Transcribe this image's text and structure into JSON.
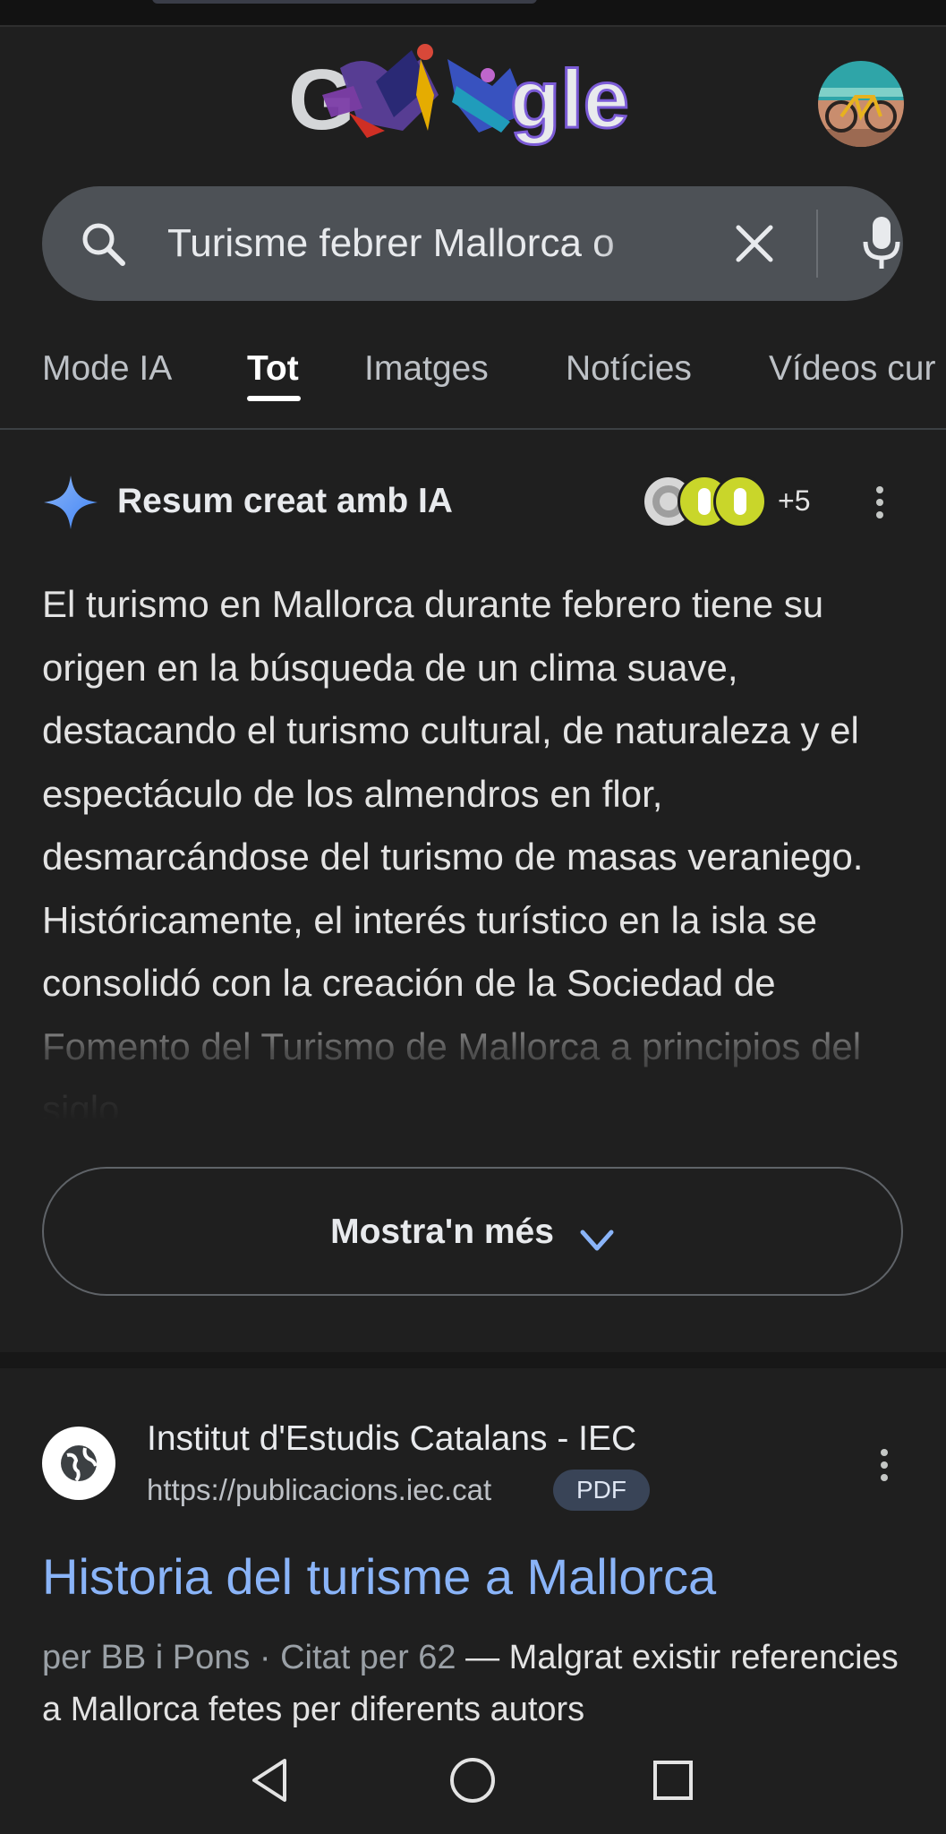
{
  "search": {
    "query": "Turisme febrer Mallorca o"
  },
  "tabs": [
    {
      "label": "Mode IA",
      "active": false
    },
    {
      "label": "Tot",
      "active": true
    },
    {
      "label": "Imatges",
      "active": false
    },
    {
      "label": "Notícies",
      "active": false
    },
    {
      "label": "Vídeos cur",
      "active": false
    }
  ],
  "ai_overview": {
    "title": "Resum creat amb IA",
    "sources_more": "+5",
    "body": "El turismo en Mallorca durante febrero tiene su origen en la búsqueda de un clima suave, destacando el turismo cultural, de naturaleza y el espectáculo de los almendros en flor, desmarcándose del turismo de masas veraniego. Históricamente, el interés turístico en la isla se consolidó con la creación de la Sociedad de Fomento del Turismo de Mallorca a principios del siglo",
    "show_more": "Mostra'n més"
  },
  "result": {
    "site_name": "Institut d'Estudis Catalans - IEC",
    "url": "https://publicacions.iec.cat",
    "badge": "PDF",
    "title": "Historia del turisme a Mallorca",
    "meta": "per BB i Pons · Citat per 62",
    "snippet": " — Malgrat existir referencies a Mallorca fetes per diferents autors"
  },
  "colors": {
    "background": "#1f1f1f",
    "link": "#8ab4f8",
    "search_bg": "#4d5156",
    "ai_spark": "#4285f4"
  },
  "icons": [
    "search-icon",
    "close-icon",
    "mic-icon",
    "sparkle-icon",
    "more-vert-icon",
    "chevron-down-icon",
    "globe-icon",
    "back-icon",
    "home-icon",
    "recents-icon"
  ]
}
